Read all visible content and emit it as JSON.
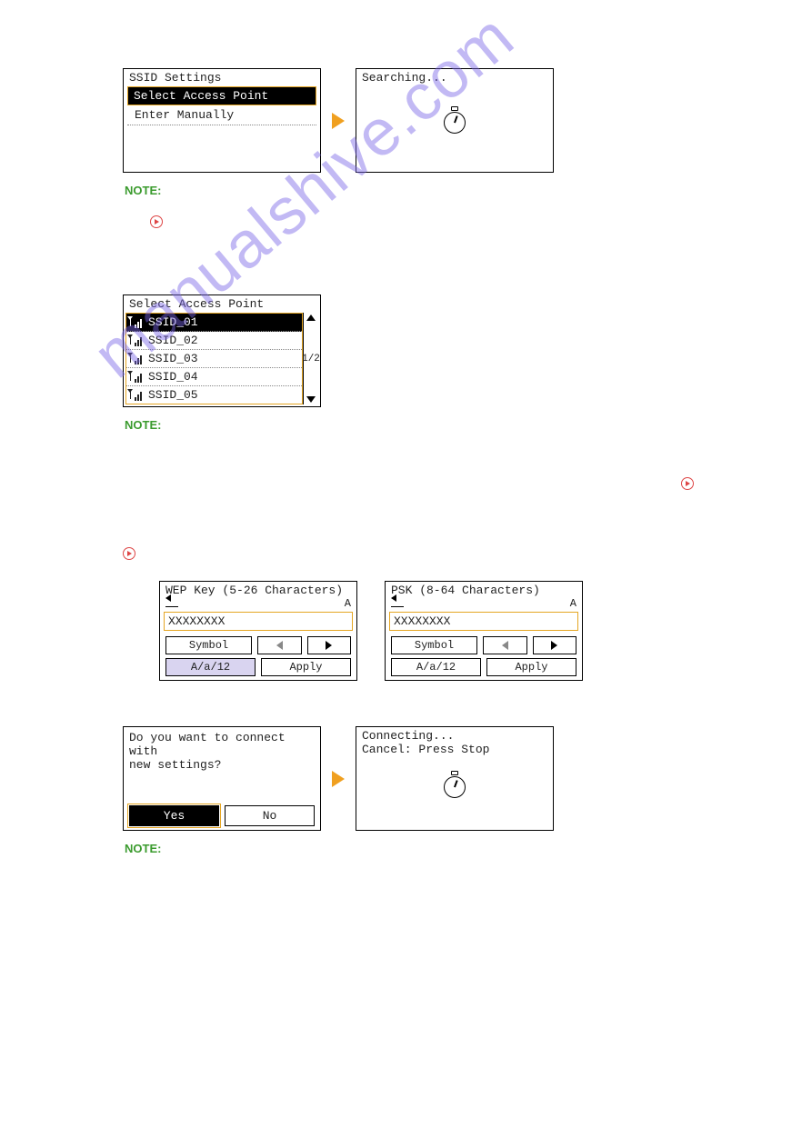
{
  "ssid_settings": {
    "title": "SSID Settings",
    "items": [
      "Select Access Point",
      "Enter Manually"
    ],
    "selected_index": 0
  },
  "searching_panel": {
    "text": "Searching..."
  },
  "note_label": "NOTE:",
  "ap_list": {
    "title": "Select Access Point",
    "items": [
      "SSID_01",
      "SSID_02",
      "SSID_03",
      "SSID_04",
      "SSID_05"
    ],
    "selected_index": 0,
    "page_indicator": "1/2"
  },
  "wep_panel": {
    "title": "WEP Key (5-26 Characters)",
    "mode_indicator": "A",
    "value": "XXXXXXXX",
    "buttons": {
      "symbol": "Symbol",
      "mode": "A/a/12",
      "apply": "Apply"
    }
  },
  "psk_panel": {
    "title": "PSK (8-64 Characters)",
    "mode_indicator": "A",
    "value": "XXXXXXXX",
    "buttons": {
      "symbol": "Symbol",
      "mode": "A/a/12",
      "apply": "Apply"
    }
  },
  "confirm_panel": {
    "message_line1": "Do you want to connect with",
    "message_line2": "new settings?",
    "yes": "Yes",
    "no": "No"
  },
  "connecting_panel": {
    "line1": "Connecting...",
    "line2": "Cancel: Press Stop"
  }
}
